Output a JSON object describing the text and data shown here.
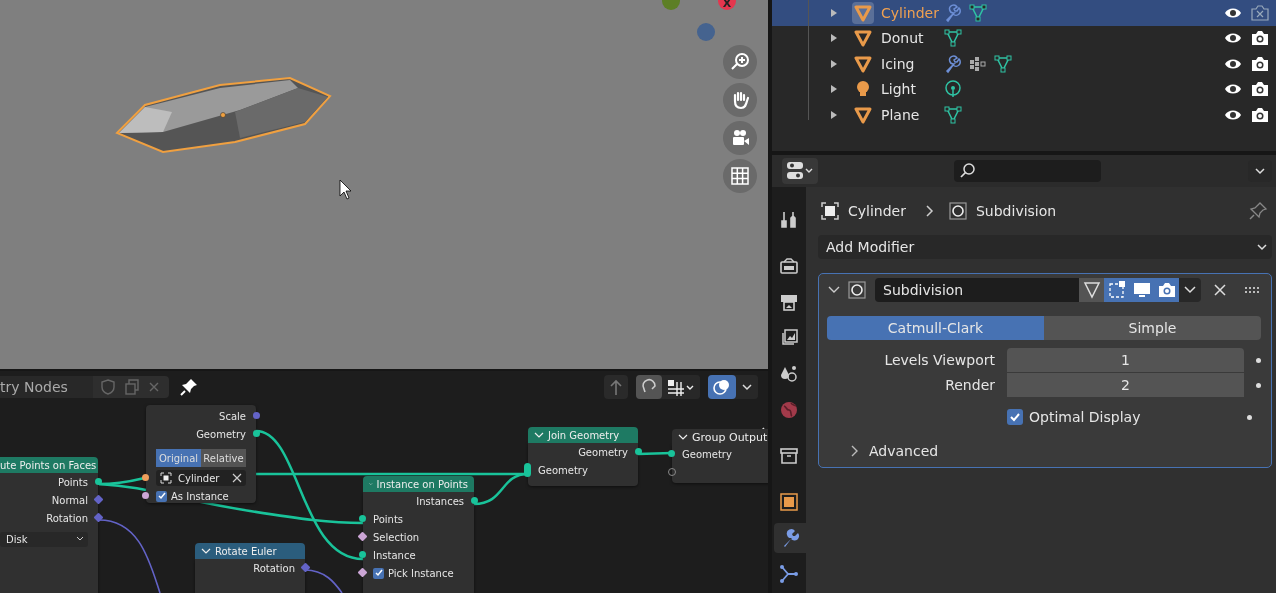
{
  "viewport": {
    "axes": [
      {
        "kind": "y",
        "color": "#5d7f25"
      },
      {
        "kind": "x",
        "label": "X",
        "color": "#e5364e"
      },
      {
        "kind": "z",
        "color": "#45638f"
      }
    ]
  },
  "node_editor": {
    "tree_name": "try Nodes",
    "overlay_on": true,
    "nodes": [
      {
        "title": "ute Points on Faces",
        "kind": "geometry",
        "rows": [
          {
            "kind": "output",
            "label": "Points",
            "socket": {
              "kind": "geometry"
            }
          },
          {
            "kind": "output",
            "label": "Normal",
            "socket": {
              "kind": "vector_field"
            }
          },
          {
            "kind": "output",
            "label": "Rotation",
            "socket": {
              "kind": "vector_field"
            }
          },
          {
            "kind": "dropdown",
            "value": "Disk"
          }
        ]
      },
      {
        "rows": [
          {
            "kind": "output",
            "label": "Scale",
            "socket": {
              "kind": "vector"
            }
          },
          {
            "kind": "output",
            "label": "Geometry",
            "socket": {
              "kind": "geometry"
            }
          },
          {
            "kind": "toggle",
            "options": [
              {
                "label": "Original",
                "selected": true
              },
              {
                "label": "Relative",
                "selected": false
              }
            ]
          },
          {
            "kind": "object_field",
            "value": "Cylinder",
            "socket": {
              "kind": "object"
            }
          },
          {
            "kind": "checkbox",
            "label": "As Instance",
            "checked": true,
            "socket": {
              "kind": "boolean"
            }
          }
        ]
      },
      {
        "title": "Instance on Points",
        "kind": "geometry",
        "rows": [
          {
            "kind": "output",
            "label": "Instances",
            "socket": {
              "kind": "geometry"
            }
          },
          {
            "kind": "input",
            "label": "Points",
            "socket": {
              "kind": "geometry"
            }
          },
          {
            "kind": "input",
            "label": "Selection",
            "socket": {
              "kind": "boolean_field"
            }
          },
          {
            "kind": "input",
            "label": "Instance",
            "socket": {
              "kind": "geometry"
            }
          },
          {
            "kind": "checkbox",
            "label": "Pick Instance",
            "checked": true,
            "socket": {
              "kind": "boolean_field"
            }
          }
        ]
      },
      {
        "title": "Rotate Euler",
        "kind": "vector",
        "rows": [
          {
            "kind": "output",
            "label": "Rotation",
            "socket": {
              "kind": "vector_field"
            }
          }
        ]
      },
      {
        "title": "Join Geometry",
        "kind": "geometry",
        "rows": [
          {
            "kind": "output",
            "label": "Geometry",
            "socket": {
              "kind": "geometry"
            }
          },
          {
            "kind": "input",
            "label": "Geometry",
            "socket": {
              "kind": "multi"
            }
          }
        ]
      },
      {
        "title": "Group Output",
        "kind": "output",
        "rows": [
          {
            "kind": "input",
            "label": "Geometry",
            "socket": {
              "kind": "geometry"
            }
          },
          {
            "kind": "input",
            "socket": {
              "kind": "empty"
            }
          }
        ]
      }
    ]
  },
  "outliner": {
    "rows": [
      {
        "name": "Cylinder",
        "kind": "mesh",
        "selected": true,
        "badges": [
          {
            "kind": "modifier"
          },
          {
            "kind": "mesh"
          }
        ],
        "renderable": false
      },
      {
        "name": "Donut",
        "kind": "mesh",
        "selected": false,
        "badges": [
          {
            "kind": "mesh"
          }
        ],
        "renderable": true
      },
      {
        "name": "Icing",
        "kind": "mesh",
        "selected": false,
        "badges": [
          {
            "kind": "modifier"
          },
          {
            "kind": "particles"
          },
          {
            "kind": "mesh"
          }
        ],
        "renderable": true
      },
      {
        "name": "Light",
        "kind": "light",
        "selected": false,
        "badges": [
          {
            "kind": "light"
          }
        ],
        "renderable": true
      },
      {
        "name": "Plane",
        "kind": "mesh",
        "selected": false,
        "badges": [
          {
            "kind": "mesh"
          }
        ],
        "renderable": true
      }
    ]
  },
  "properties": {
    "tabs": [
      {
        "kind": "tool",
        "selected": false
      },
      {
        "kind": "render",
        "selected": false
      },
      {
        "kind": "output",
        "selected": false
      },
      {
        "kind": "view_layer",
        "selected": false
      },
      {
        "kind": "scene",
        "selected": false
      },
      {
        "kind": "world",
        "selected": false
      },
      {
        "kind": "collection",
        "selected": false
      },
      {
        "kind": "object",
        "selected": false
      },
      {
        "kind": "modifier",
        "selected": true
      },
      {
        "kind": "particles",
        "selected": false
      }
    ],
    "breadcrumb": [
      "Cylinder",
      "Subdivision"
    ],
    "add_modifier": "Add Modifier",
    "modifier": {
      "name": "Subdivision",
      "expanded": true,
      "toggles": [
        {
          "kind": "on_cage",
          "on": false
        },
        {
          "kind": "edit_mode",
          "on": true
        },
        {
          "kind": "viewport",
          "on": true
        },
        {
          "kind": "render",
          "on": true
        }
      ],
      "methods": [
        {
          "label": "Catmull-Clark",
          "selected": true
        },
        {
          "label": "Simple",
          "selected": false
        }
      ],
      "fields": [
        {
          "label": "Levels Viewport",
          "value": "1"
        },
        {
          "label": "Render",
          "value": "2"
        }
      ],
      "optimal_display": {
        "label": "Optimal Display",
        "checked": true
      },
      "advanced": {
        "label": "Advanced",
        "expanded": false
      }
    }
  }
}
